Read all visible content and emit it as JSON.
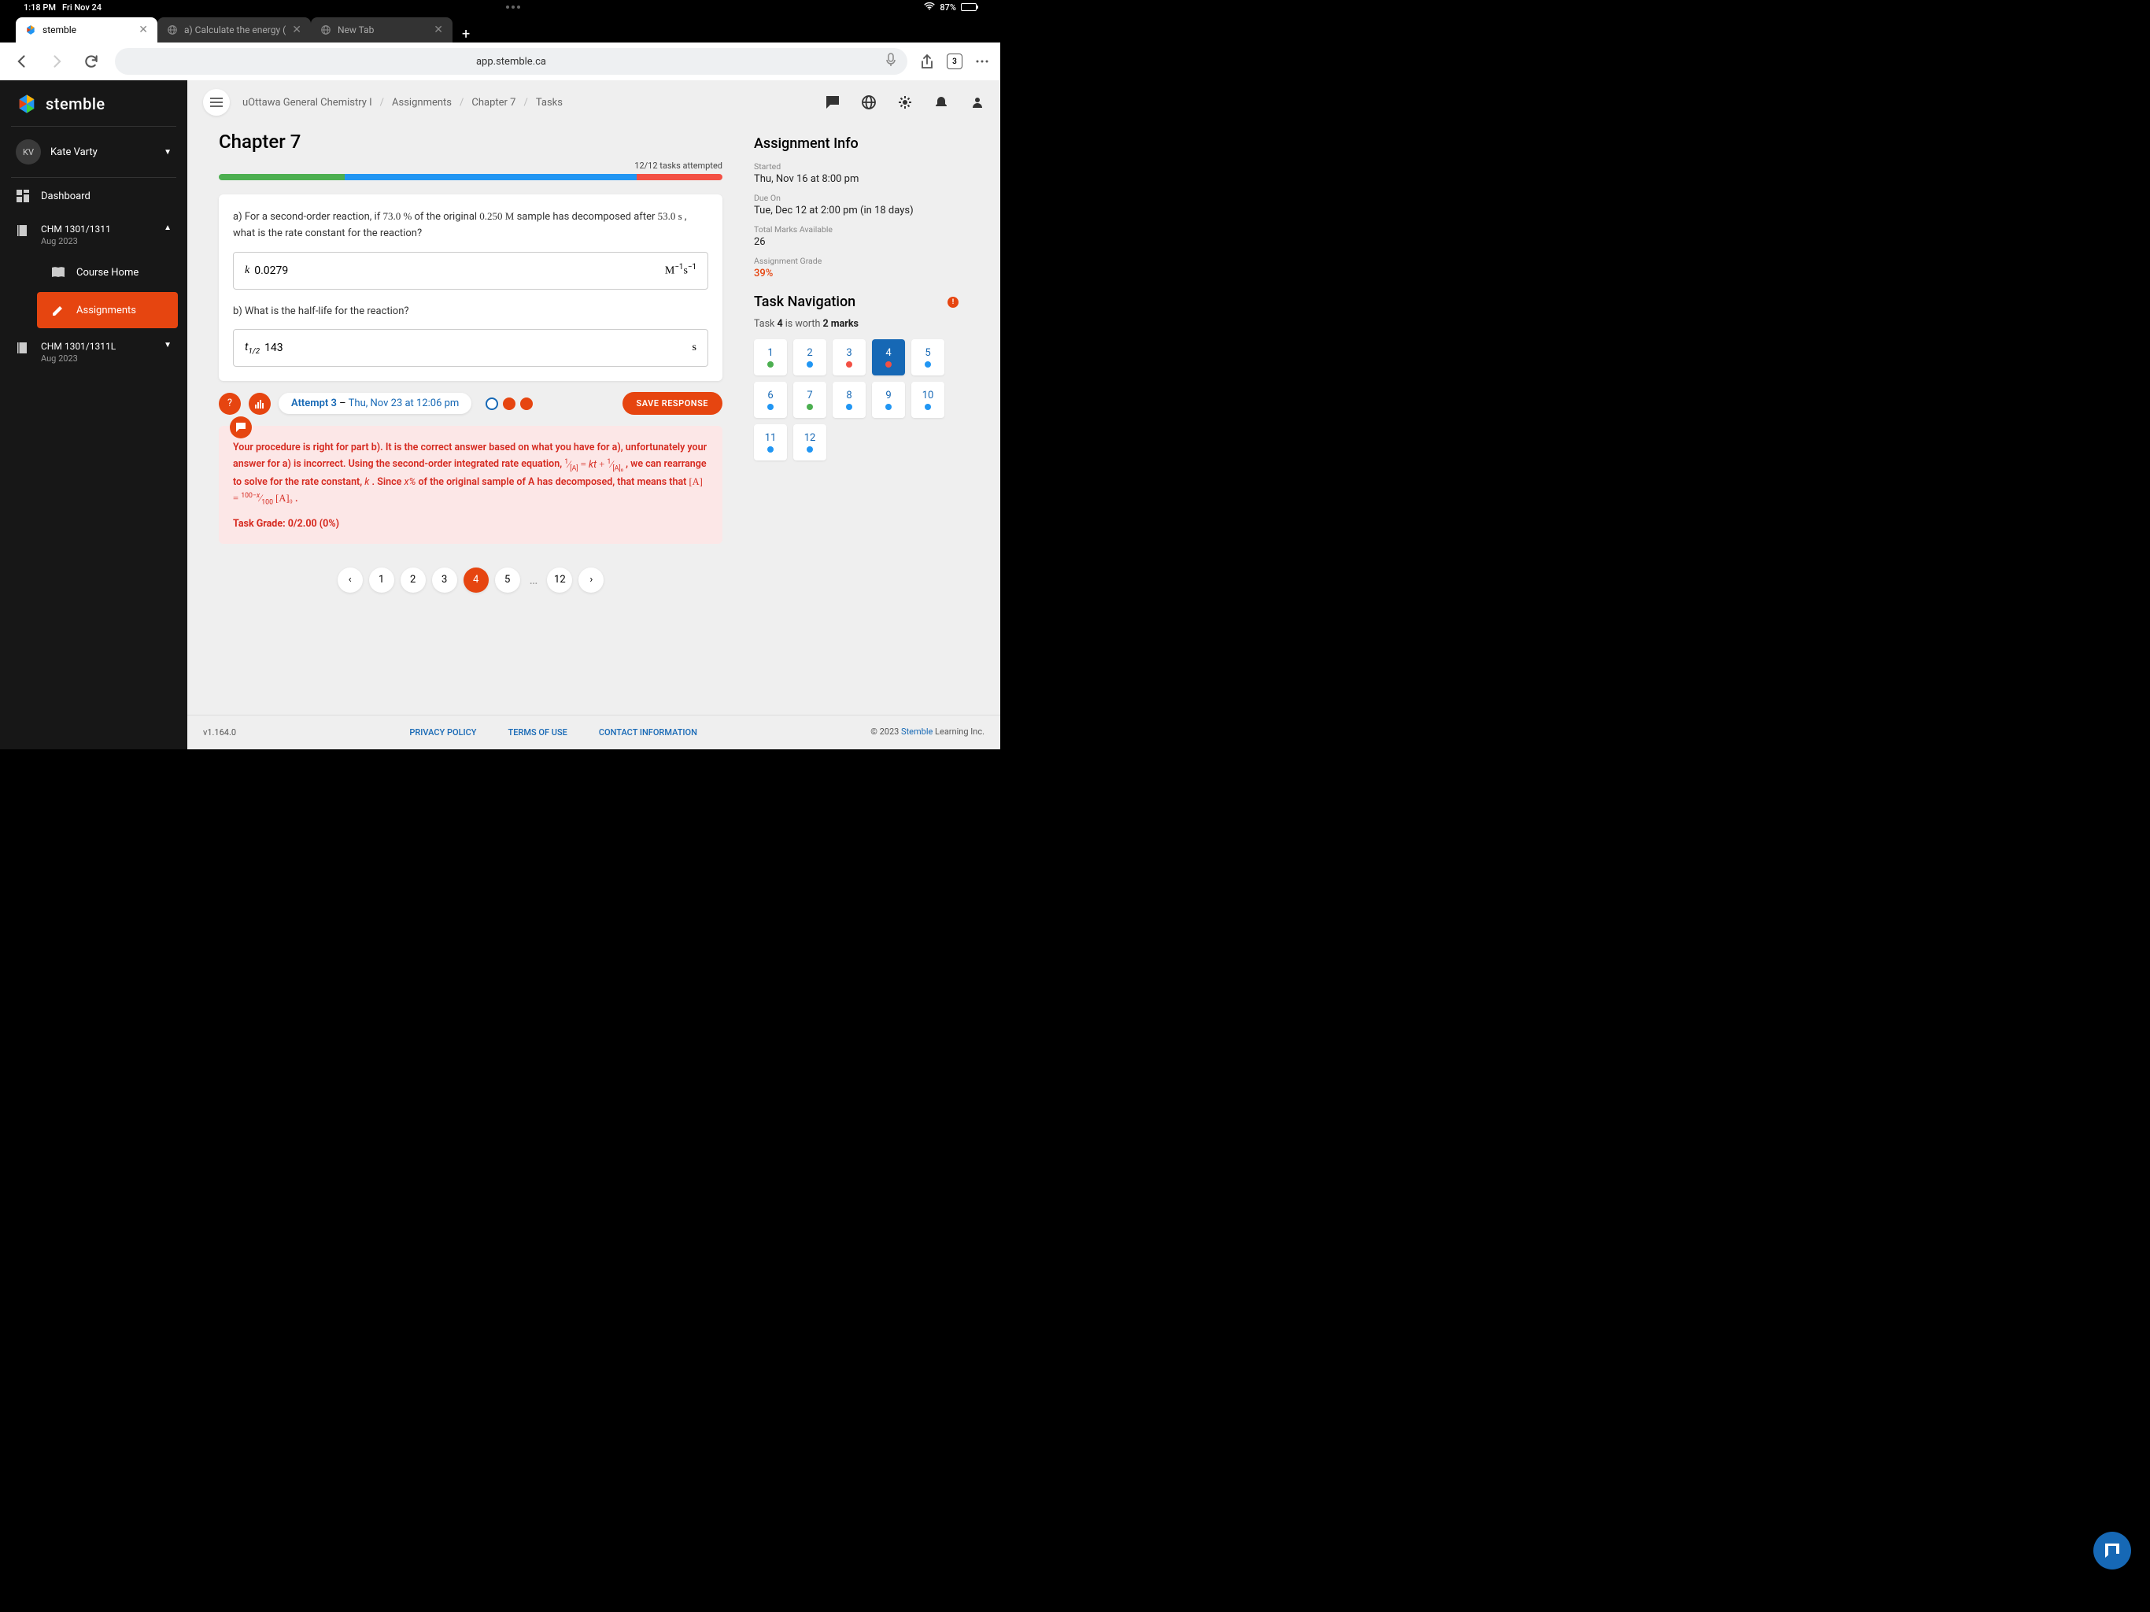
{
  "status": {
    "time": "1:18 PM",
    "date": "Fri Nov 24",
    "battery": "87%"
  },
  "tabs": [
    {
      "title": "stemble",
      "active": true
    },
    {
      "title": "a) Calculate the energy (",
      "active": false
    },
    {
      "title": "New Tab",
      "active": false
    }
  ],
  "tab_count": "3",
  "url": "app.stemble.ca",
  "sidebar": {
    "brand": "stemble",
    "user_initials": "KV",
    "user_name": "Kate Varty",
    "dashboard": "Dashboard",
    "course1": {
      "title": "CHM 1301/1311",
      "sub": "Aug 2023"
    },
    "course_home": "Course Home",
    "assignments": "Assignments",
    "course2": {
      "title": "CHM 1301/1311L",
      "sub": "Aug 2023"
    }
  },
  "breadcrumb": [
    "uOttawa General Chemistry I",
    "Assignments",
    "Chapter 7",
    "Tasks"
  ],
  "page": {
    "title": "Chapter 7",
    "attempts": "12/12 tasks attempted"
  },
  "qa": {
    "a_prefix": "a) For a second-order reaction, if ",
    "a_pct": "73.0 %",
    "a_mid1": " of the original ",
    "a_conc": "0.250 M",
    "a_mid2": " sample has decomposed after ",
    "a_time": "53.0 s",
    "a_suffix": " , what is the rate constant for the reaction?",
    "a_var": "k",
    "a_val": "0.0279",
    "a_unit": "M⁻¹s⁻¹",
    "b_text": "b) What is the half-life for the reaction?",
    "b_var": "t",
    "b_sub": "1/2",
    "b_val": "143",
    "b_unit": "s"
  },
  "attempt": {
    "label": "Attempt 3",
    "sep": " – ",
    "date": "Thu, Nov 23 at 12:06 pm",
    "save": "SAVE RESPONSE"
  },
  "feedback": {
    "line1_a": "Your procedure is right for part b). It is the correct answer based on what you have for a), unfortunately your answer for a) is incorrect. Using the second-order integrated rate equation, ",
    "eq1": "1/[A] = kt + 1/[A]₀",
    "line1_b": " , we can rearrange to solve for the rate constant, ",
    "kvar": "k",
    "line1_c": " . Since ",
    "xvar": "x%",
    "line1_d": " of the original sample of A has decomposed, that means that ",
    "eq2": "[A] = ((100−x)/100)[A]₀",
    "line1_e": " .",
    "grade": "Task Grade: 0/2.00 (0%)"
  },
  "pagination": {
    "pages": [
      "1",
      "2",
      "3",
      "4",
      "5"
    ],
    "last": "12",
    "active": "4"
  },
  "info": {
    "title": "Assignment Info",
    "started_label": "Started",
    "started": "Thu, Nov 16 at 8:00 pm",
    "due_label": "Due On",
    "due": "Tue, Dec 12 at 2:00 pm (in 18 days)",
    "marks_label": "Total Marks Available",
    "marks": "26",
    "grade_label": "Assignment Grade",
    "grade": "39%"
  },
  "tasknav": {
    "title": "Task Navigation",
    "worth_a": "Task ",
    "worth_num": "4",
    "worth_b": " is worth ",
    "worth_marks": "2 marks",
    "cells": [
      {
        "n": "1",
        "c": "green"
      },
      {
        "n": "2",
        "c": "blue"
      },
      {
        "n": "3",
        "c": "red"
      },
      {
        "n": "4",
        "c": "red",
        "active": true
      },
      {
        "n": "5",
        "c": "blue"
      },
      {
        "n": "6",
        "c": "blue"
      },
      {
        "n": "7",
        "c": "green"
      },
      {
        "n": "8",
        "c": "blue"
      },
      {
        "n": "9",
        "c": "blue"
      },
      {
        "n": "10",
        "c": "blue"
      },
      {
        "n": "11",
        "c": "blue"
      },
      {
        "n": "12",
        "c": "blue"
      }
    ]
  },
  "footer": {
    "version": "v1.164.0",
    "links": [
      "PRIVACY POLICY",
      "TERMS OF USE",
      "CONTACT INFORMATION"
    ],
    "copy1": "© 2023 ",
    "copy_link": "Stemble",
    "copy2": " Learning Inc."
  }
}
